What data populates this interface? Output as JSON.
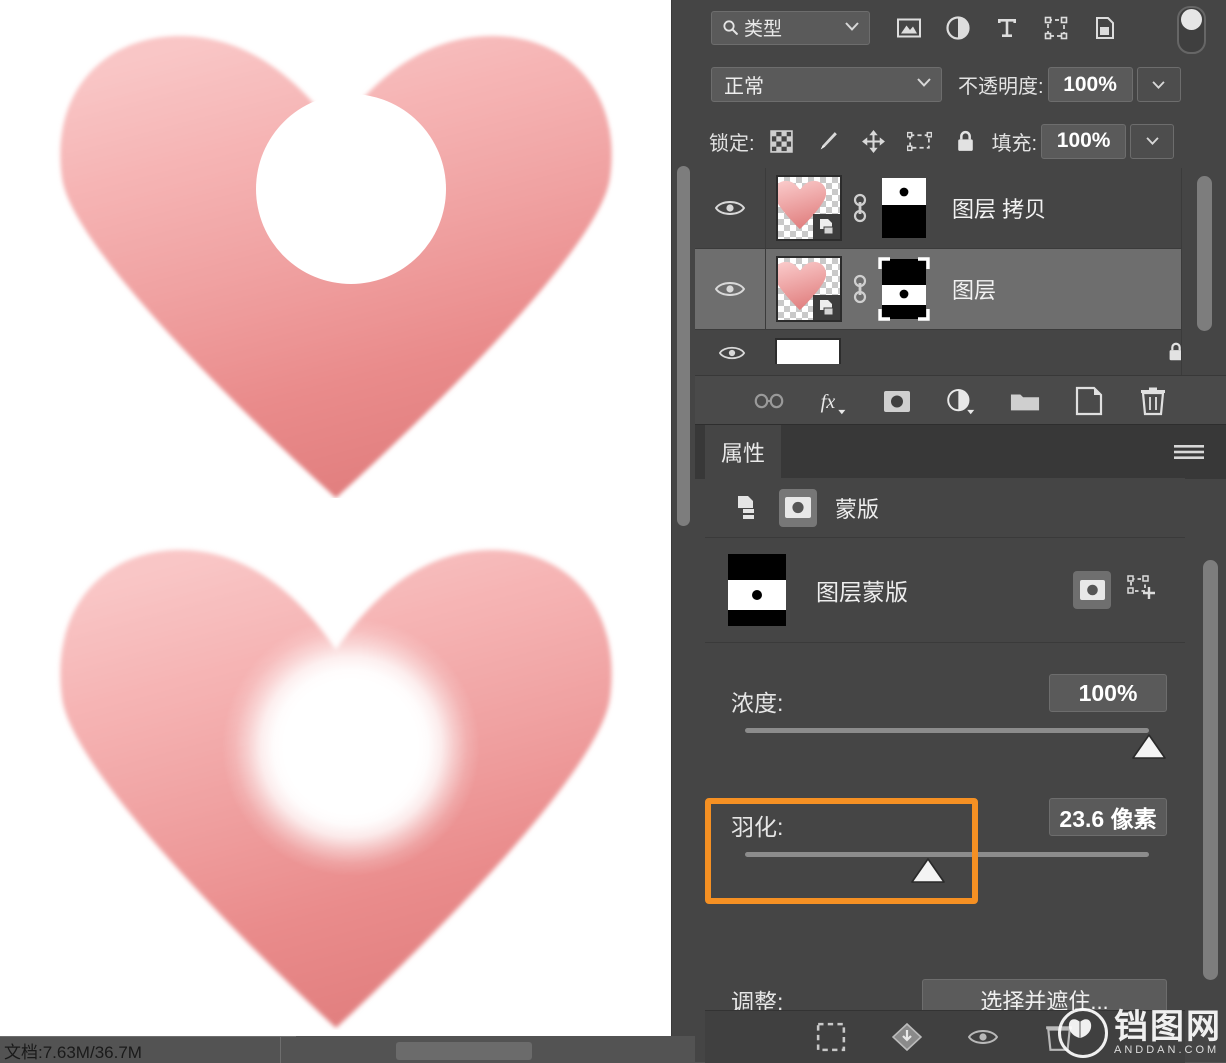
{
  "canvas": {
    "top_heart": {
      "name": "heart-sharp-circle",
      "fill_top": "#f7bdbd",
      "fill_bottom": "#e07e7e",
      "cutout": "sharp"
    },
    "bottom_heart": {
      "name": "heart-feathered-circle",
      "fill_top": "#f7bdbd",
      "fill_bottom": "#e07e7e",
      "cutout": "feathered"
    }
  },
  "statusbar": {
    "document_info": "文档:7.63M/36.7M",
    "caret": "›"
  },
  "layers_panel": {
    "filter": {
      "search_label": "类型",
      "icons": [
        "image-filter-icon",
        "adjustment-filter-icon",
        "text-filter-icon",
        "shape-filter-icon",
        "smart-object-filter-icon"
      ],
      "toggle": "filter-enable-toggle"
    },
    "blend": {
      "mode": "正常",
      "opacity_label": "不透明度:",
      "opacity_value": "100%"
    },
    "lock": {
      "label": "锁定:",
      "icons": [
        "lock-transparency-icon",
        "lock-image-icon",
        "lock-position-icon",
        "lock-artboard-icon",
        "lock-all-icon"
      ],
      "fill_label": "填充:",
      "fill_value": "100%"
    },
    "layers": [
      {
        "name": "图层 拷贝",
        "visible": true,
        "selected": false,
        "mask": "top-white-bottom-black",
        "has_link": true
      },
      {
        "name": "图层",
        "visible": true,
        "selected": true,
        "mask": "top-black-bottom-white",
        "has_link": true
      },
      {
        "name": "",
        "visible": true,
        "selected": false,
        "mask": "",
        "has_link": false,
        "locked": true,
        "partial": true
      }
    ],
    "bottom_icons": [
      "link-layers-icon",
      "layer-style-fx-icon",
      "add-mask-icon",
      "adjustment-layer-icon",
      "new-group-icon",
      "new-layer-icon",
      "delete-layer-icon"
    ]
  },
  "properties_panel": {
    "tab": "属性",
    "menu_icon": "panel-menu-icon",
    "header": {
      "label": "蒙版",
      "icons": [
        "mask-type-icon",
        "pixel-mask-icon"
      ]
    },
    "mask_item": {
      "label": "图层蒙版",
      "actions": [
        "select-pixel-mask-icon",
        "select-vector-mask-icon"
      ]
    },
    "density": {
      "label": "浓度:",
      "value": "100%",
      "slider_percent": 100
    },
    "feather": {
      "label": "羽化:",
      "value": "23.6 像素",
      "slider_percent": 49,
      "highlighted": true,
      "highlight_color": "#f59023"
    },
    "adjust": {
      "label": "调整:",
      "button_label": "选择并遮住..."
    },
    "bottom_icons": [
      "load-selection-icon",
      "apply-mask-icon",
      "toggle-mask-icon",
      "delete-mask-icon"
    ]
  },
  "watermark": {
    "brand": "铛图网",
    "domain": "ANDDAN.COM"
  }
}
